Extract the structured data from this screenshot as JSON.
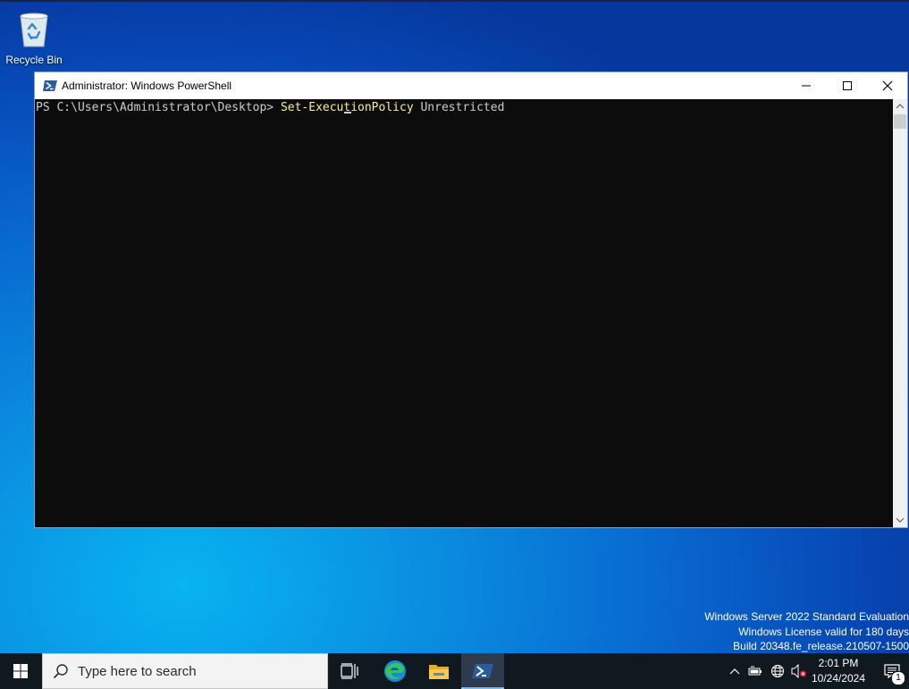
{
  "desktop": {
    "recycle_bin_label": "Recycle Bin",
    "recycle_bin_icon": "recycle-bin-icon"
  },
  "window": {
    "title": "Administrator: Windows PowerShell",
    "icon": "powershell-icon",
    "controls": [
      "minimize-icon",
      "maximize-icon",
      "close-icon"
    ]
  },
  "console": {
    "prompt": "PS C:\\Users\\Administrator\\Desktop> ",
    "command": "Set-ExecutionPolicy",
    "argument": " Unrestricted",
    "background": "#0c0c0c",
    "text_color": "#cccccc",
    "command_color": "#f5f08e"
  },
  "watermark": {
    "line1": "Windows Server 2022 Standard Evaluation",
    "line2": "Windows License valid for 180 days",
    "line3": "Build 20348.fe_release.210507-1500"
  },
  "taskbar": {
    "search_placeholder": "Type here to search",
    "items": [
      "start-icon",
      "task-view-icon",
      "edge-icon",
      "file-explorer-icon",
      "powershell-icon"
    ],
    "tray_icons": [
      "chevron-up-icon",
      "battery-icon",
      "network-icon",
      "volume-muted-icon"
    ],
    "clock_time": "2:01 PM",
    "clock_date": "10/24/2024",
    "notification_count": "1",
    "accent": "#76b9ed"
  }
}
